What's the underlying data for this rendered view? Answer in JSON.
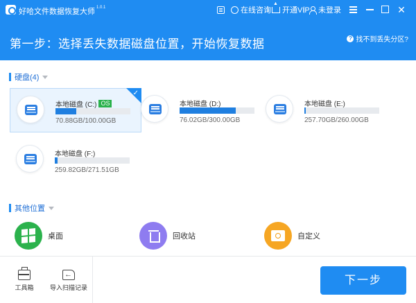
{
  "titlebar": {
    "app_name": "好哈文件数据恢复大师",
    "version": "1.0.1",
    "consult_label": "在线咨询",
    "vip_label": "开通VIP",
    "login_label": "未登录"
  },
  "header": {
    "step_title": "第一步：选择丢失数据磁盘位置，开始恢复数据",
    "help_label": "找不到丢失分区?"
  },
  "disks_section": {
    "title": "硬盘(4)",
    "disks": [
      {
        "name": "本地磁盘 (C:)",
        "badge": "OS",
        "usage": "70.88GB/100.00GB",
        "used_fraction": 0.28,
        "selected": true
      },
      {
        "name": "本地磁盘 (D:)",
        "usage": "76.02GB/300.00GB",
        "used_fraction": 0.75,
        "selected": false
      },
      {
        "name": "本地磁盘 (E:)",
        "usage": "257.70GB/260.00GB",
        "used_fraction": 0.02,
        "selected": false
      },
      {
        "name": "本地磁盘 (F:)",
        "usage": "259.82GB/271.51GB",
        "used_fraction": 0.04,
        "selected": false
      }
    ]
  },
  "other_section": {
    "title": "其他位置",
    "items": [
      {
        "label": "桌面",
        "icon": "windows-icon",
        "color": "#2bb24c"
      },
      {
        "label": "回收站",
        "icon": "trash-icon",
        "color": "#8e7cf0"
      },
      {
        "label": "自定义",
        "icon": "folder-search-icon",
        "color": "#f6a623"
      }
    ]
  },
  "footer": {
    "toolbox_label": "工具箱",
    "import_label": "导入扫描记录",
    "next_label": "下一步"
  },
  "colors": {
    "brand": "#1f8cf2",
    "os_badge": "#2bb24c"
  }
}
